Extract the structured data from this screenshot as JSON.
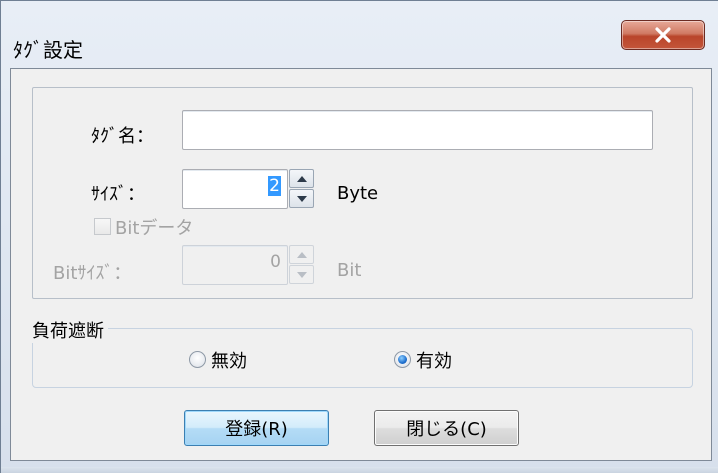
{
  "window": {
    "title": "ﾀｸﾞ設定"
  },
  "form": {
    "tag_name_label": "ﾀｸﾞ名：",
    "tag_name_value": "",
    "size_label": "ｻｲｽﾞ：",
    "size_value": "2",
    "size_unit": "Byte",
    "bit_data_label": "Bitデータ",
    "bit_data_checked": false,
    "bit_size_label": "Bitｻｲｽﾞ：",
    "bit_size_value": "0",
    "bit_size_unit": "Bit"
  },
  "load_cut": {
    "legend": "負荷遮断",
    "options": [
      {
        "label": "無効",
        "selected": false
      },
      {
        "label": "有効",
        "selected": true
      }
    ]
  },
  "buttons": {
    "register_label": "登録(R)",
    "close_label": "閉じる(C)"
  },
  "colors": {
    "close_button": "#c4553a",
    "selection": "#3399ff",
    "disabled_text": "#a3a3a3"
  },
  "icons": {
    "close": "close-x-icon",
    "spin_up": "triangle-up-icon",
    "spin_down": "triangle-down-icon"
  }
}
